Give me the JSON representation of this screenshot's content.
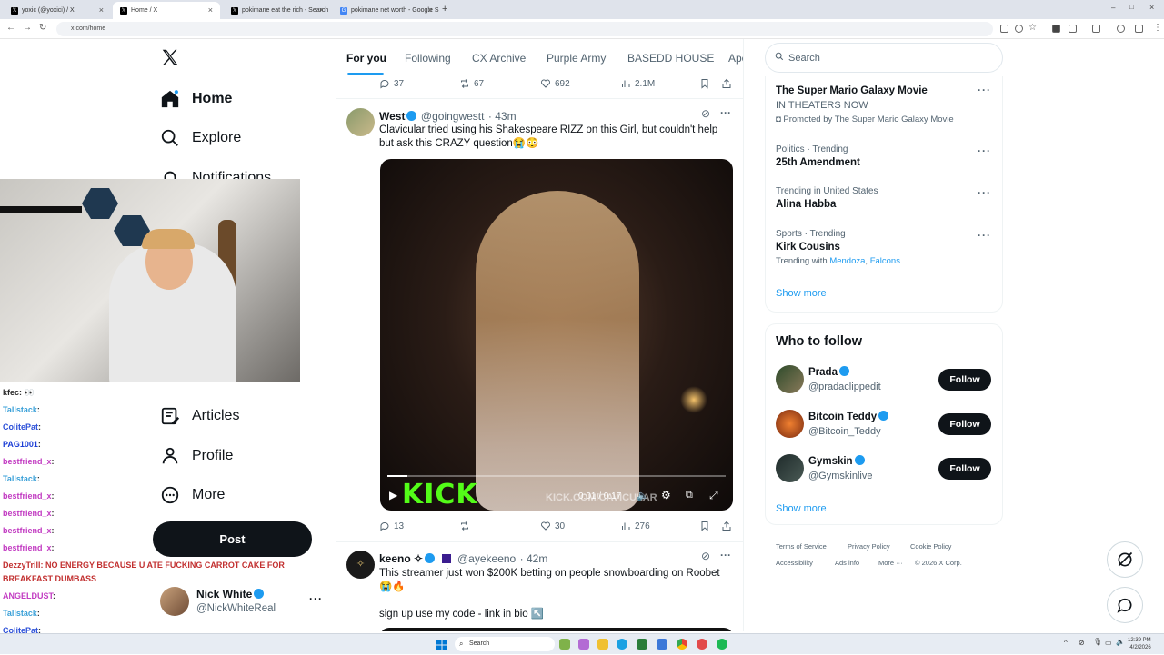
{
  "browser": {
    "tabs": [
      {
        "title": "yoxic (@yoxici) / X",
        "active": false
      },
      {
        "title": "Home / X",
        "active": true
      },
      {
        "title": "pokimane eat the rich - Search",
        "active": false
      },
      {
        "title": "pokimane net worth - Google S",
        "active": false
      }
    ],
    "url": "x.com/home"
  },
  "nav": {
    "items": [
      {
        "label": "Home",
        "icon": "home-icon"
      },
      {
        "label": "Explore",
        "icon": "search-icon"
      },
      {
        "label": "Notifications",
        "icon": "bell-icon"
      },
      {
        "label": "Articles",
        "icon": "articles-icon"
      },
      {
        "label": "Profile",
        "icon": "person-icon"
      },
      {
        "label": "More",
        "icon": "more-circle-icon"
      }
    ],
    "post_label": "Post",
    "account": {
      "name": "Nick White",
      "handle": "@NickWhiteReal"
    }
  },
  "feed": {
    "tabs": [
      "For you",
      "Following",
      "CX Archive",
      "Purple Army",
      "BASEDD HOUSE",
      "Ape"
    ],
    "top_actions": {
      "replies": "37",
      "reposts": "67",
      "likes": "692",
      "views": "2.1M"
    },
    "tweets": [
      {
        "name": "West",
        "handle": "@goingwestt",
        "time": "· 43m",
        "text": "Clavicular tried using his Shakespeare RIZZ on this Girl, but couldn't help but ask this CRAZY question😭😳",
        "video": {
          "watermark": "KICK",
          "overlay": "KICK.COM/CAVICULAR",
          "time": "0:01 / 0:17",
          "progress": 0.06
        },
        "actions": {
          "replies": "13",
          "reposts": "",
          "likes": "30",
          "views": "276"
        }
      },
      {
        "name": "keeno ✧",
        "handle": "@ayekeeno",
        "time": "· 42m",
        "text": "This streamer just won $200K betting on people snowboarding on Roobet 😭🔥",
        "text2": "sign up use my code - link in bio ↖️"
      }
    ]
  },
  "sidebar": {
    "search_placeholder": "Search",
    "trends": [
      {
        "title": "The Super Mario Galaxy Movie",
        "line2": "IN THEATERS NOW",
        "line3": "Promoted by The Super Mario Galaxy Movie"
      },
      {
        "meta": "Politics · Trending",
        "title": "25th Amendment"
      },
      {
        "meta": "Trending in United States",
        "title": "Alina Habba"
      },
      {
        "meta": "Sports · Trending",
        "title": "Kirk Cousins",
        "extra_prefix": "Trending with",
        "extra_links": [
          "Mendoza",
          "Falcons"
        ]
      }
    ],
    "trends_show_more": "Show more",
    "who_to_follow_title": "Who to follow",
    "follows": [
      {
        "name": "Prada",
        "handle": "@pradaclippedit",
        "button": "Follow"
      },
      {
        "name": "Bitcoin Teddy",
        "handle": "@Bitcoin_Teddy",
        "button": "Follow"
      },
      {
        "name": "Gymskin",
        "handle": "@Gymskinlive",
        "button": "Follow"
      }
    ],
    "follows_show_more": "Show more",
    "footer": [
      "Terms of Service",
      "Privacy Policy",
      "Cookie Policy",
      "Accessibility",
      "Ads info",
      "More ···",
      "© 2026 X Corp."
    ]
  },
  "chat": [
    {
      "user": "kfec",
      "msg": ": 👀",
      "color": "#2a2a2a"
    },
    {
      "user": "Tallstack",
      "msg": ":",
      "color": "#3aa0d8"
    },
    {
      "user": "ColitePat",
      "msg": ":",
      "color": "#2b4fd8"
    },
    {
      "user": "PAG1001",
      "msg": ":",
      "color": "#1c3ed6"
    },
    {
      "user": "bestfriend_x",
      "msg": ":",
      "color": "#c23bc2"
    },
    {
      "user": "Tallstack",
      "msg": ":",
      "color": "#3aa0d8"
    },
    {
      "user": "bestfriend_x",
      "msg": ":",
      "color": "#c23bc2"
    },
    {
      "user": "bestfriend_x",
      "msg": ":",
      "color": "#c23bc2"
    },
    {
      "user": "bestfriend_x",
      "msg": ":",
      "color": "#c23bc2"
    },
    {
      "user": "bestfriend_x",
      "msg": ":",
      "color": "#c23bc2"
    },
    {
      "user": "DezzyTrill",
      "msg": ": NO ENERGY BECAUSE U ATE FUCKING CARROT CAKE FOR",
      "color": "#c23030"
    },
    {
      "user": "",
      "msg": "BREAKFAST DUMBASS",
      "color": "#c23030"
    },
    {
      "user": "ANGELDUST",
      "msg": ":",
      "color": "#c23bc2"
    },
    {
      "user": "Tallstack",
      "msg": ":",
      "color": "#3aa0d8"
    },
    {
      "user": "ColitePat",
      "msg": ":",
      "color": "#2b4fd8"
    }
  ],
  "taskbar": {
    "search_label": "Search",
    "time": "12:39 PM",
    "date": "4/2/2026"
  }
}
